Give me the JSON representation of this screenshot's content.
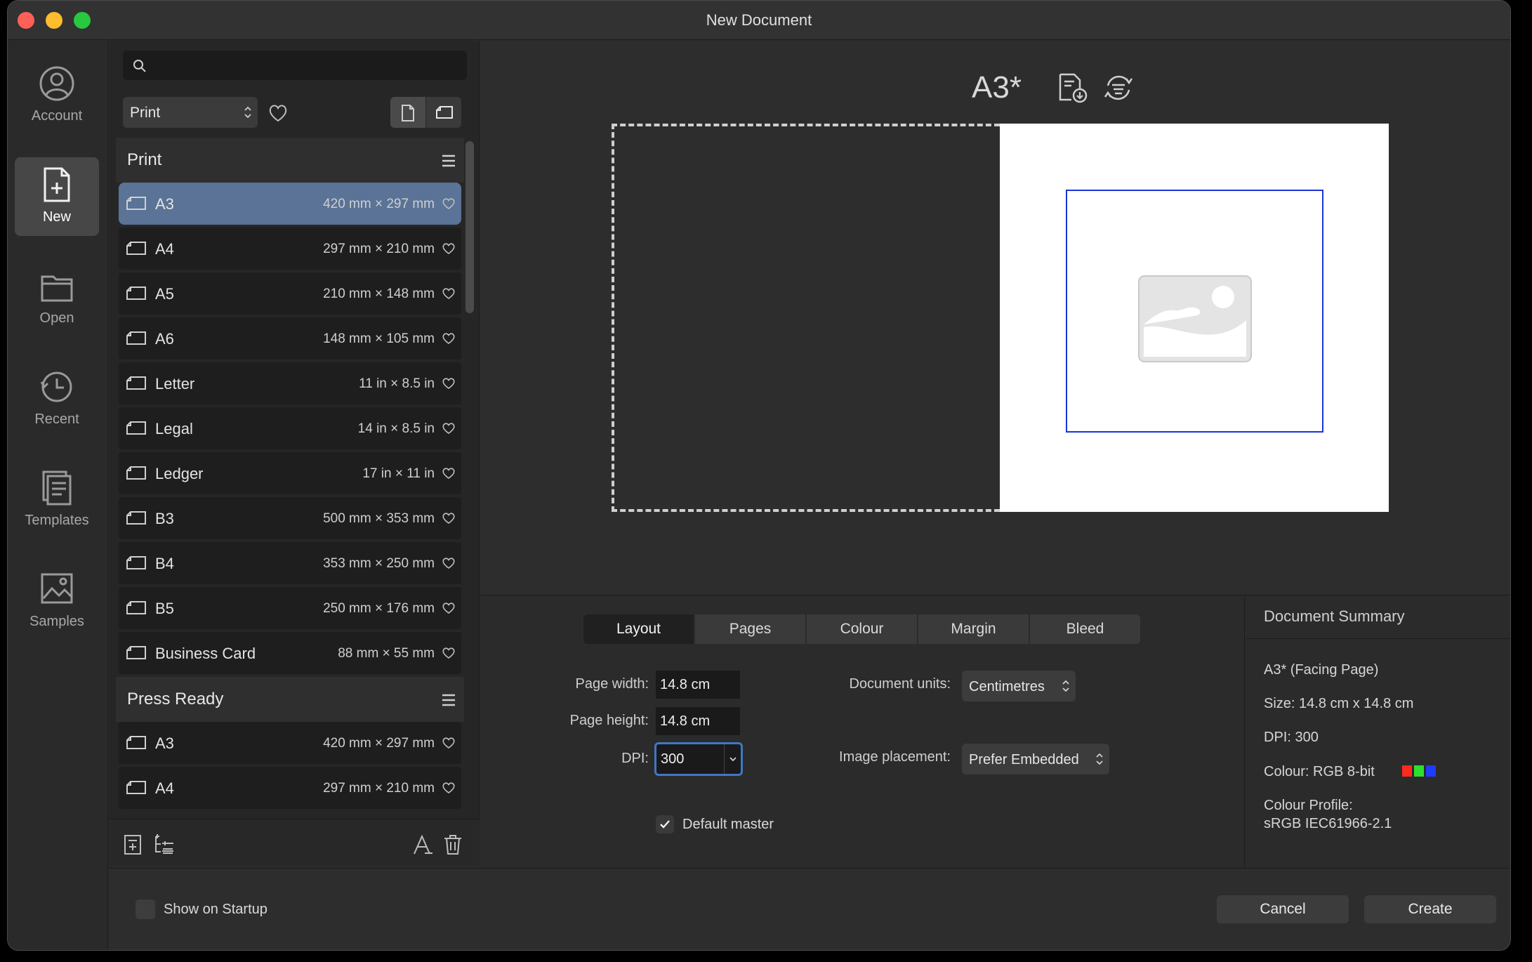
{
  "window": {
    "title": "New Document"
  },
  "nav": {
    "items": [
      {
        "label": "Account",
        "icon": "account-icon"
      },
      {
        "label": "New",
        "icon": "new-document-icon",
        "active": true
      },
      {
        "label": "Open",
        "icon": "folder-icon"
      },
      {
        "label": "Recent",
        "icon": "clock-icon"
      },
      {
        "label": "Templates",
        "icon": "templates-icon"
      },
      {
        "label": "Samples",
        "icon": "samples-icon"
      }
    ]
  },
  "presets": {
    "search_value": "",
    "category": "Print",
    "groups": [
      {
        "title": "Print",
        "items": [
          {
            "name": "A3",
            "size": "420 mm × 297 mm",
            "selected": true
          },
          {
            "name": "A4",
            "size": "297 mm × 210 mm"
          },
          {
            "name": "A5",
            "size": "210 mm × 148 mm"
          },
          {
            "name": "A6",
            "size": "148 mm × 105 mm"
          },
          {
            "name": "Letter",
            "size": "11 in × 8.5 in"
          },
          {
            "name": "Legal",
            "size": "14 in × 8.5 in"
          },
          {
            "name": "Ledger",
            "size": "17 in × 11 in"
          },
          {
            "name": "B3",
            "size": "500 mm × 353 mm"
          },
          {
            "name": "B4",
            "size": "353 mm × 250 mm"
          },
          {
            "name": "B5",
            "size": "250 mm × 176 mm"
          },
          {
            "name": "Business Card",
            "size": "88 mm × 55 mm"
          }
        ]
      },
      {
        "title": "Press Ready",
        "items": [
          {
            "name": "A3",
            "size": "420 mm × 297 mm"
          },
          {
            "name": "A4",
            "size": "297 mm × 210 mm"
          }
        ]
      }
    ]
  },
  "preview": {
    "doc_name": "A3*"
  },
  "tabs": [
    "Layout",
    "Pages",
    "Colour",
    "Margin",
    "Bleed"
  ],
  "layout": {
    "page_width_label": "Page width:",
    "page_width": "14.8 cm",
    "page_height_label": "Page height:",
    "page_height": "14.8 cm",
    "dpi_label": "DPI:",
    "dpi": "300",
    "units_label": "Document units:",
    "units": "Centimetres",
    "placement_label": "Image placement:",
    "placement": "Prefer Embedded",
    "default_master_label": "Default master",
    "default_master_checked": true
  },
  "summary": {
    "title": "Document Summary",
    "name": "A3* (Facing Page)",
    "size": "Size: 14.8 cm x 14.8 cm",
    "dpi": "DPI:  300",
    "colour": "Colour: RGB 8-bit",
    "profile_label": "Colour Profile:",
    "profile": "sRGB IEC61966-2.1",
    "swatches": [
      "#ff2a1f",
      "#2ee02e",
      "#1e3cff"
    ]
  },
  "footer": {
    "show_on_startup": "Show on Startup",
    "cancel": "Cancel",
    "create": "Create"
  }
}
